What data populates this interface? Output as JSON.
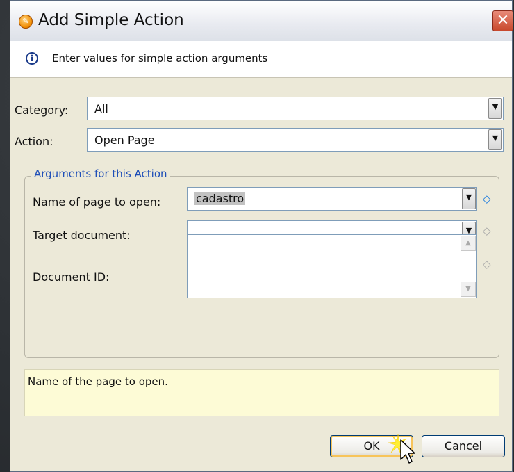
{
  "window": {
    "title": "Add Simple Action",
    "close_glyph": "✕"
  },
  "info": {
    "icon": "info-icon",
    "message": "Enter values for simple action arguments"
  },
  "form": {
    "category": {
      "label": "Category:",
      "value": "All"
    },
    "action": {
      "label": "Action:",
      "value": "Open Page"
    }
  },
  "arguments": {
    "group_title": "Arguments for this Action",
    "items": [
      {
        "label": "Name of page to open:",
        "value": "cadastro",
        "required": true
      },
      {
        "label": "Target document:",
        "value": "",
        "required": false
      },
      {
        "label": "Document ID:",
        "value": "",
        "required": false
      }
    ]
  },
  "description": "Name of the page to open.",
  "buttons": {
    "ok": "OK",
    "cancel": "Cancel"
  },
  "colors": {
    "group_title": "#1f4fb8",
    "required_marker": "#1a7adf",
    "optional_marker": "#a8a8a8",
    "description_bg": "#fdfbd6"
  }
}
